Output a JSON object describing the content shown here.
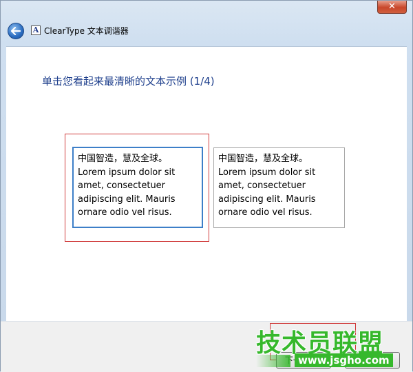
{
  "window": {
    "close_glyph": "✕",
    "back_icon": "back-arrow-icon",
    "app_icon_letter": "A",
    "app_title": "ClearType 文本调谐器"
  },
  "main": {
    "heading": "单击您看起来最清晰的文本示例 (1/4)",
    "samples": [
      {
        "lines": [
          "中国智造，慧及全球。",
          "Lorem ipsum dolor sit",
          "amet, consectetuer",
          "adipiscing elit. Mauris",
          "ornare odio vel risus."
        ],
        "selected": true
      },
      {
        "lines": [
          "中国智造，慧及全球。",
          "Lorem ipsum dolor sit",
          "amet, consectetuer",
          "adipiscing elit. Mauris",
          "ornare odio vel risus."
        ],
        "selected": false
      }
    ]
  },
  "footer": {
    "next_label": "下一步(N)",
    "cancel_label": "取消"
  },
  "watermark": {
    "title": "技术员联盟",
    "url": "www.jsgho.com"
  },
  "colors": {
    "heading": "#1e3f8c",
    "selected_border": "#3d7fc8",
    "highlight_red": "#d03a3a",
    "watermark_green": "#36b82c"
  }
}
